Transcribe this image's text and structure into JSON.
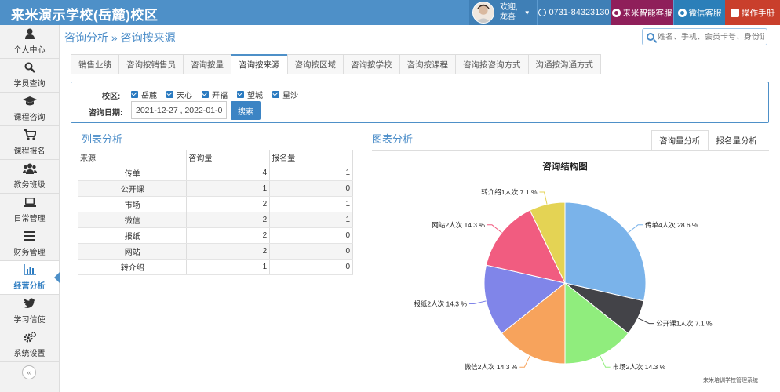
{
  "header": {
    "brand": "来米演示学校(岳麓)校区",
    "welcome_line1": "欢迎,",
    "welcome_line2": "龙喜",
    "phone": "0731-84323130",
    "kefu": "来米智能客服",
    "wechat": "微信客服",
    "manual": "操作手册"
  },
  "sidebar": {
    "items": [
      {
        "label": "个人中心",
        "icon": "user-icon"
      },
      {
        "label": "学员查询",
        "icon": "search-icon"
      },
      {
        "label": "课程咨询",
        "icon": "graduation-cap-icon"
      },
      {
        "label": "课程报名",
        "icon": "cart-icon"
      },
      {
        "label": "教务班级",
        "icon": "users-icon"
      },
      {
        "label": "日常管理",
        "icon": "laptop-icon"
      },
      {
        "label": "财务管理",
        "icon": "list-icon"
      },
      {
        "label": "经营分析",
        "icon": "bar-chart-icon"
      },
      {
        "label": "学习信使",
        "icon": "twitter-icon"
      },
      {
        "label": "系统设置",
        "icon": "gears-icon"
      }
    ],
    "active_index": 7,
    "collapse": "«"
  },
  "breadcrumb": "咨询分析 » 咨询按来源",
  "search": {
    "placeholder": "姓名、手机、会员卡号、身份证"
  },
  "tabs": [
    "销售业绩",
    "咨询按销售员",
    "咨询按量",
    "咨询按来源",
    "咨询按区域",
    "咨询按学校",
    "咨询按课程",
    "咨询按咨询方式",
    "沟通按沟通方式"
  ],
  "active_tab": 3,
  "filter": {
    "campus_label": "校区:",
    "campuses": [
      "岳麓",
      "天心",
      "开福",
      "望城",
      "星沙"
    ],
    "date_label": "咨询日期:",
    "date_value": "2021-12-27 , 2022-01-0",
    "search_button": "搜索"
  },
  "list": {
    "title": "列表分析",
    "headers": [
      "来源",
      "咨询量",
      "报名量"
    ],
    "rows": [
      [
        "传单",
        "4",
        "1"
      ],
      [
        "公开课",
        "1",
        "0"
      ],
      [
        "市场",
        "2",
        "1"
      ],
      [
        "微信",
        "2",
        "1"
      ],
      [
        "报纸",
        "2",
        "0"
      ],
      [
        "网站",
        "2",
        "0"
      ],
      [
        "转介绍",
        "1",
        "0"
      ]
    ]
  },
  "chart_section": {
    "title": "图表分析",
    "tabs": [
      "咨询量分析",
      "报名量分析"
    ]
  },
  "chart_data": {
    "type": "pie",
    "title": "咨询结构图",
    "slices": [
      {
        "name": "传单",
        "value": 4,
        "label": "传单4人次 28.6 %",
        "color": "#7ab3ea"
      },
      {
        "name": "公开课",
        "value": 1,
        "label": "公开课1人次 7.1 %",
        "color": "#434348"
      },
      {
        "name": "市场",
        "value": 2,
        "label": "市场2人次 14.3 %",
        "color": "#90ed7d"
      },
      {
        "name": "微信",
        "value": 2,
        "label": "微信2人次 14.3 %",
        "color": "#f7a35c"
      },
      {
        "name": "报纸",
        "value": 2,
        "label": "报纸2人次 14.3 %",
        "color": "#8085e9"
      },
      {
        "name": "网站",
        "value": 2,
        "label": "网站2人次 14.3 %",
        "color": "#f15c80"
      },
      {
        "name": "转介绍",
        "value": 1,
        "label": "转介绍1人次 7.1 %",
        "color": "#e4d354"
      }
    ]
  },
  "footer": "来米培训学校管理系统"
}
